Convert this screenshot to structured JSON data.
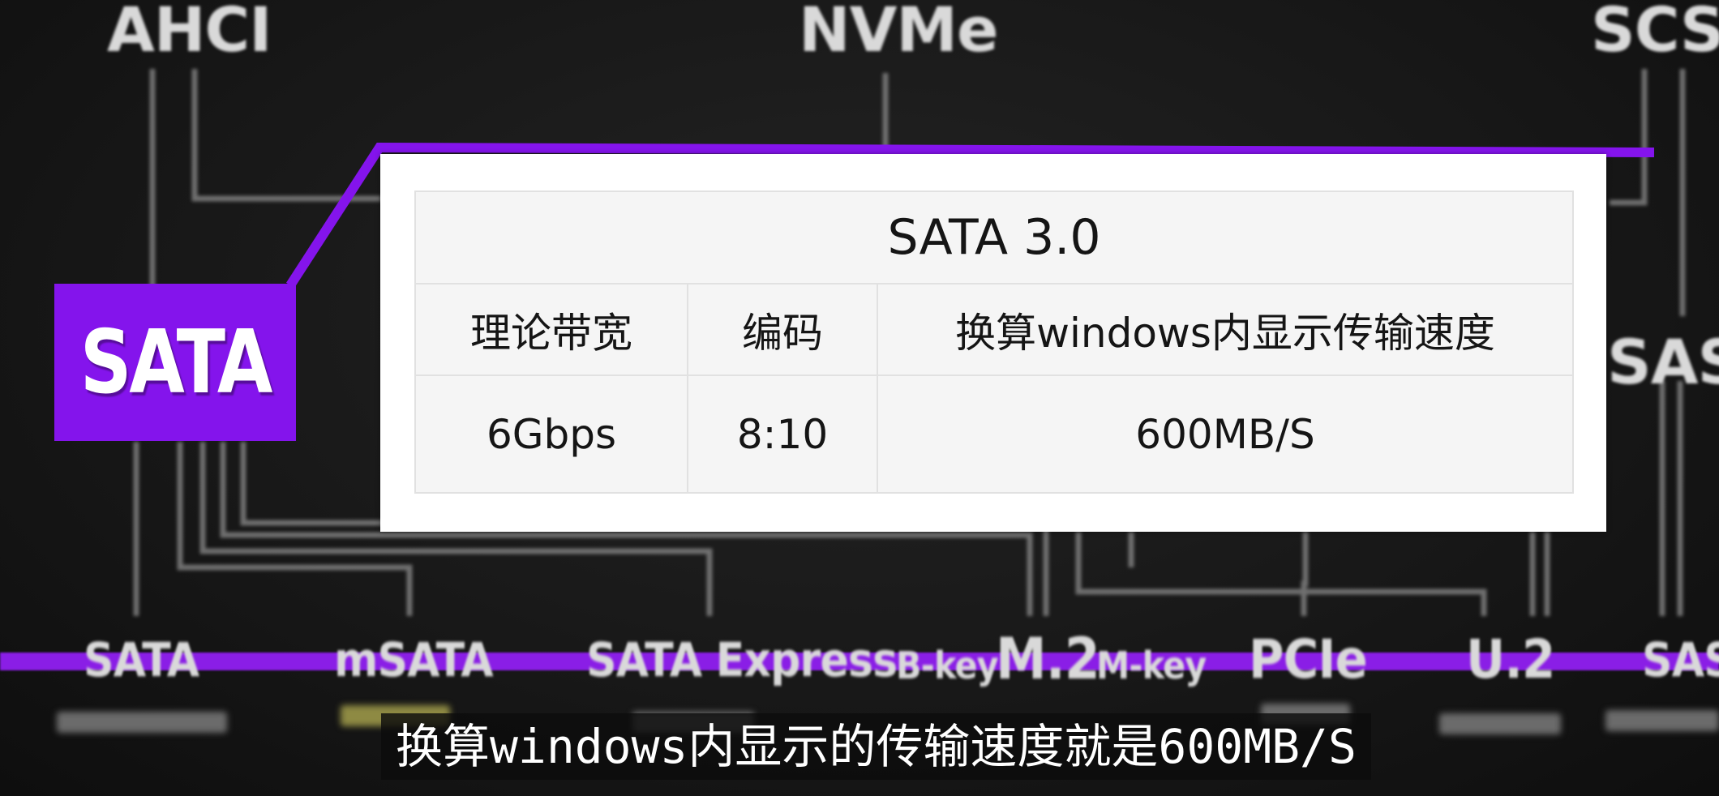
{
  "background": {
    "top_labels": [
      "AHCI",
      "NVMe",
      "SCSI"
    ],
    "side_label": "SAS",
    "bottom_labels": [
      "SATA",
      "mSATA",
      "SATA Express",
      "B-key",
      "M.2",
      "M-key",
      "PCIe",
      "U.2",
      "SAS"
    ]
  },
  "badge": {
    "label": "SATA"
  },
  "table": {
    "title": "SATA 3.0",
    "headers": [
      "理论带宽",
      "编码",
      "换算windows内显示传输速度"
    ],
    "row": [
      "6Gbps",
      "8:10",
      "600MB/S"
    ]
  },
  "subtitle": {
    "text": "换算windows内显示的传输速度就是600MB/S"
  },
  "colors": {
    "accent": "#8414ec",
    "card": "#ffffff",
    "table_bg": "#f5f5f5",
    "table_border": "#e1e1e1",
    "background": "#161616"
  }
}
